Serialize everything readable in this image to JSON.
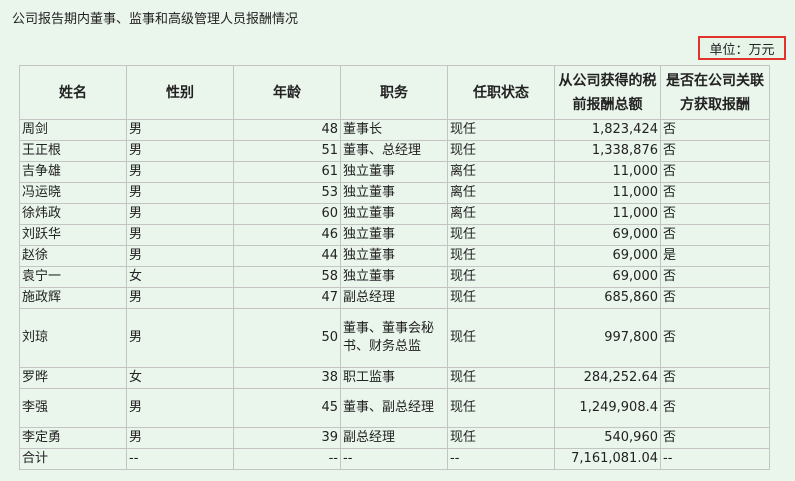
{
  "title": "公司报告期内董事、监事和高级管理人员报酬情况",
  "unit": "单位：万元",
  "headers": {
    "name": "姓名",
    "gender": "性别",
    "age": "年龄",
    "position": "职务",
    "status": "任职状态",
    "pay": "从公司获得的税前报酬总额",
    "related": "是否在公司关联方获取报酬"
  },
  "rows": [
    {
      "name": "周剑",
      "gender": "男",
      "age": "48",
      "position": "董事长",
      "status": "现任",
      "pay": "1,823,424",
      "related": "否"
    },
    {
      "name": "王正根",
      "gender": "男",
      "age": "51",
      "position": "董事、总经理",
      "status": "现任",
      "pay": "1,338,876",
      "related": "否"
    },
    {
      "name": "吉争雄",
      "gender": "男",
      "age": "61",
      "position": "独立董事",
      "status": "离任",
      "pay": "11,000",
      "related": "否"
    },
    {
      "name": "冯运晓",
      "gender": "男",
      "age": "53",
      "position": "独立董事",
      "status": "离任",
      "pay": "11,000",
      "related": "否"
    },
    {
      "name": "徐炜政",
      "gender": "男",
      "age": "60",
      "position": "独立董事",
      "status": "离任",
      "pay": "11,000",
      "related": "否"
    },
    {
      "name": "刘跃华",
      "gender": "男",
      "age": "46",
      "position": "独立董事",
      "status": "现任",
      "pay": "69,000",
      "related": "否"
    },
    {
      "name": "赵徐",
      "gender": "男",
      "age": "44",
      "position": "独立董事",
      "status": "现任",
      "pay": "69,000",
      "related": "是"
    },
    {
      "name": "袁宁一",
      "gender": "女",
      "age": "58",
      "position": "独立董事",
      "status": "现任",
      "pay": "69,000",
      "related": "否"
    },
    {
      "name": "施政辉",
      "gender": "男",
      "age": "47",
      "position": "副总经理",
      "status": "现任",
      "pay": "685,860",
      "related": "否"
    },
    {
      "name": "刘琼",
      "gender": "男",
      "age": "50",
      "position": "董事、董事会秘书、财务总监",
      "status": "现任",
      "pay": "997,800",
      "related": "否"
    },
    {
      "name": "罗晔",
      "gender": "女",
      "age": "38",
      "position": "职工监事",
      "status": "现任",
      "pay": "284,252.64",
      "related": "否"
    },
    {
      "name": "李强",
      "gender": "男",
      "age": "45",
      "position": "董事、副总经理",
      "status": "现任",
      "pay": "1,249,908.4",
      "related": "否"
    },
    {
      "name": "李定勇",
      "gender": "男",
      "age": "39",
      "position": "副总经理",
      "status": "现任",
      "pay": "540,960",
      "related": "否"
    },
    {
      "name": "合计",
      "gender": "--",
      "age": "--",
      "position": "--",
      "status": "--",
      "pay": "7,161,081.04",
      "related": "--"
    }
  ]
}
